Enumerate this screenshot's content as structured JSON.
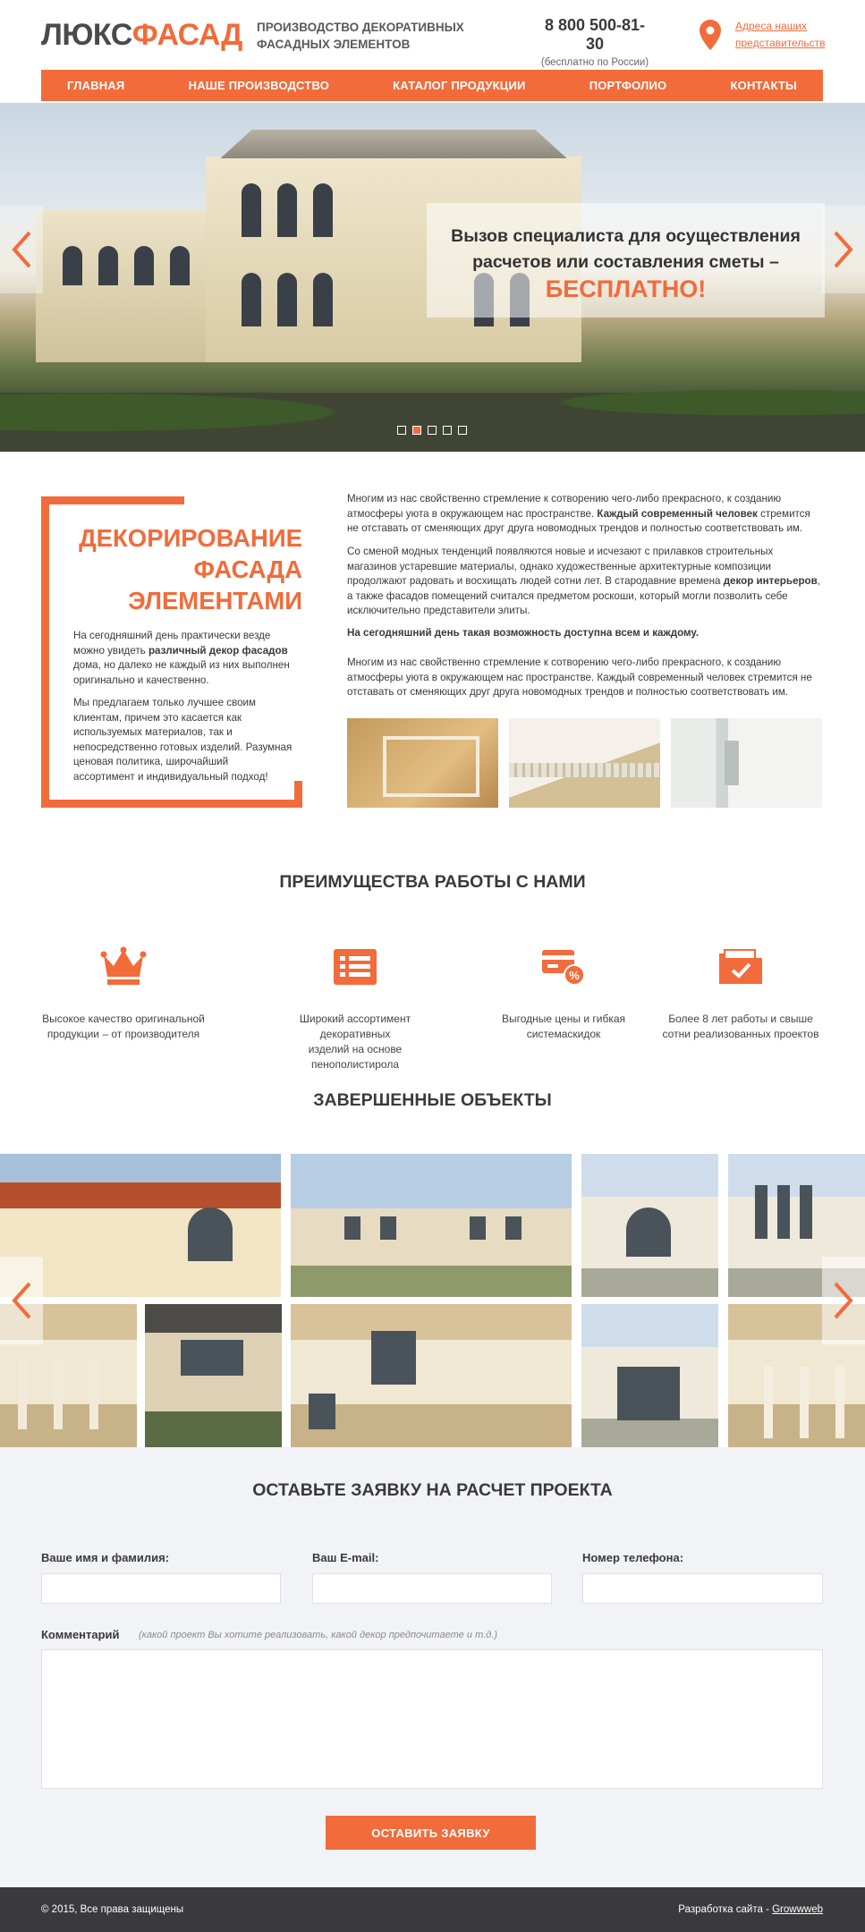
{
  "header": {
    "logo_part1": "ЛЮКС",
    "logo_part2": "ФАСАД",
    "tagline_line1": "ПРОИЗВОДСТВО ДЕКОРАТИВНЫХ",
    "tagline_line2": "ФАСАДНЫХ ЭЛЕМЕНТОВ",
    "phone": "8 800 500-81-30",
    "phone_note": "(бесплатно по России)",
    "addresses_line1": "Адреса наших",
    "addresses_line2": "представительств",
    "pin_icon": "map-pin-icon"
  },
  "nav": {
    "items": [
      {
        "label": "ГЛАВНАЯ"
      },
      {
        "label": "НАШЕ ПРОИЗВОДСТВО"
      },
      {
        "label": "КАТАЛОГ ПРОДУКЦИИ"
      },
      {
        "label": "ПОРТФОЛИО"
      },
      {
        "label": "КОНТАКТЫ"
      }
    ]
  },
  "hero": {
    "line1": "Вызов специалиста для осуществления",
    "line2": "расчетов или составления сметы –",
    "free": "БЕСПЛАТНО!",
    "prev_icon": "chevron-left-icon",
    "next_icon": "chevron-right-icon",
    "slide_count": 5,
    "active_slide": 2
  },
  "intro": {
    "title_line1": "ДЕКОРИРОВАНИЕ",
    "title_line2": "ФАСАДА",
    "title_line3": "ЭЛЕМЕНТАМИ",
    "p1_a": "На сегодняшний день практически везде можно увидеть ",
    "p1_b": "различный декор фасадов",
    "p1_c": " дома, но далеко не каждый из них выполнен оригинально и качественно.",
    "p2": "Мы предлагаем только лучшее своим клиентам, причем это касается как используемых материалов, так и непосредственно готовых изделий. Разумная ценовая политика, широчайший ассортимент и индивидуальный подход!"
  },
  "body": {
    "p1_a": "Многим из нас свойственно стремление к сотворению чего-либо прекрасного, к созданию атмосферы уюта в окружающем нас пространстве. ",
    "p1_b": "Каждый современный человек",
    "p1_c": " стремится не отставать от сменяющих друг друга новомодных трендов и полностью соответствовать им.",
    "p2_a": "Со сменой модных тенденций появляются новые и исчезают с прилавков строительных магазинов устаревшие материалы, однако художественные архитектурные композиции продолжают радовать и восхищать людей сотни лет. В стародавние времена ",
    "p2_b": "декор интерьеров",
    "p2_c": ", а также фасадов помещений считался предметом роскоши, который могли позволить себе исключительно представители элиты.",
    "p3": "На сегодняшний день такая возможность доступна всем и каждому.",
    "p4": "Многим из нас свойственно стремление к сотворению чего-либо прекрасного, к созданию атмосферы уюта в окружающем нас пространстве. Каждый современный человек стремится не отставать от сменяющих друг друга новомодных трендов и полностью соответствовать им."
  },
  "advantages": {
    "title": "ПРЕИМУЩЕСТВА РАБОТЫ С НАМИ",
    "items": [
      {
        "icon": "crown-icon",
        "line1": "Высокое качество оригинальной",
        "line2": "продукции – от производителя"
      },
      {
        "icon": "list-icon",
        "line1": "Широкий ассортимент декоративных",
        "line2": "изделий на основе пенополистирола"
      },
      {
        "icon": "discount-card-icon",
        "line1": "Выгодные цены и гибкая",
        "line2": "системаскидок"
      },
      {
        "icon": "folder-check-icon",
        "line1": "Более 8 лет работы и свыше",
        "line2": "сотни реализованных проектов"
      }
    ]
  },
  "portfolio": {
    "title": "ЗАВЕРШЕННЫЕ ОБЪЕКТЫ"
  },
  "form": {
    "title": "ОСТАВЬТЕ ЗАЯВКУ НА РАСЧЕТ ПРОЕКТА",
    "name_label": "Ваше имя и фамилия:",
    "email_label": "Ваш E-mail:",
    "phone_label": "Номер телефона:",
    "comment_label": "Комментарий",
    "comment_hint": "(какой проект Вы хотите реализовать, какой декор предпочитаете и т.д.)",
    "submit_label": "ОСТАВИТЬ ЗАЯВКУ"
  },
  "footer": {
    "copyright": "© 2015, Все права защищены",
    "dev_prefix": "Разработка сайта - ",
    "dev_link": "Growwweb"
  },
  "colors": {
    "accent": "#f26b3a",
    "text": "#3a3a3a",
    "footer_bg": "#3a3a3c",
    "form_bg": "#f2f3f7"
  }
}
